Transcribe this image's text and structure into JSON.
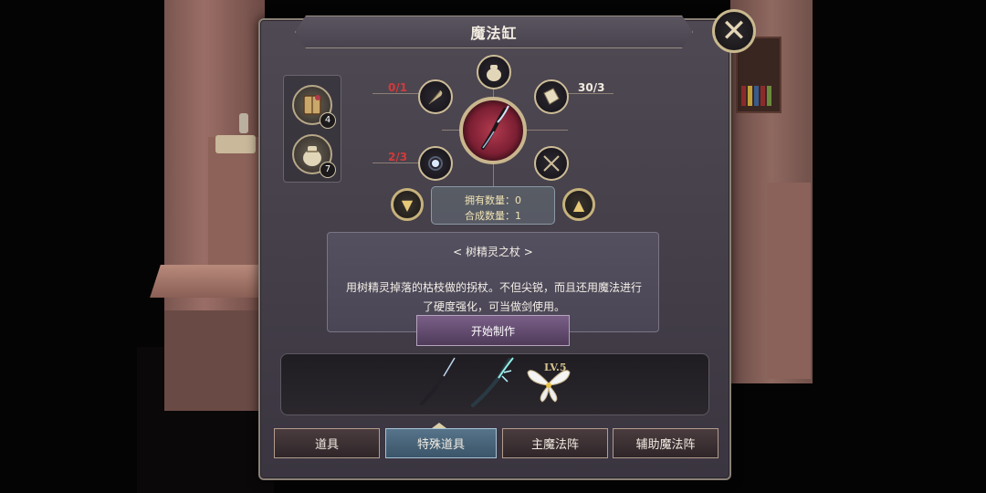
{
  "window": {
    "title": "魔法缸"
  },
  "close": {
    "icon": "close-icon"
  },
  "inventory": [
    {
      "icon": "spellbook-icon",
      "count": "4"
    },
    {
      "icon": "pouch-icon",
      "count": "7"
    }
  ],
  "recipe": {
    "slots": [
      {
        "icon": "feather-icon",
        "count": "0/1",
        "status": "insufficient"
      },
      {
        "icon": "scroll-icon",
        "count": "30/3",
        "status": "enough"
      },
      {
        "icon": "orb-icon",
        "count": "2/3",
        "status": "insufficient"
      },
      {
        "icon": "empty-slot-icon",
        "count": ""
      },
      {
        "icon": "pouch-icon",
        "count": ""
      }
    ],
    "result_icon": "elf-staff-icon",
    "owned_label": "拥有数量：",
    "owned_value": "0",
    "craft_label": "合成数量：",
    "craft_value": "1"
  },
  "item": {
    "name": "< 树精灵之杖 >",
    "description": "用树精灵掉落的枯枝做的拐杖。不但尖锐，而且还用魔法进行了硬度强化，可当做剑使用。"
  },
  "craft_button": "开始制作",
  "upgrade_strip": {
    "stages": [
      "staff-tier1-icon",
      "staff-tier2-icon",
      "fairy-wings-icon"
    ],
    "level_label": "LV.5"
  },
  "tabs": [
    {
      "label": "道具",
      "active": false
    },
    {
      "label": "特殊道具",
      "active": true
    },
    {
      "label": "主魔法阵",
      "active": false
    },
    {
      "label": "辅助魔法阵",
      "active": false
    }
  ],
  "colors": {
    "insufficient": "#d33a3a",
    "accent_gold": "#c9b68e",
    "active_tab": "#56748a"
  }
}
